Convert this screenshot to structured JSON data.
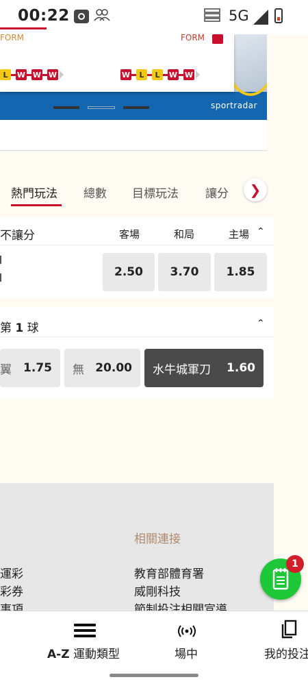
{
  "status_bar": {
    "time": "00:22",
    "network": "5G"
  },
  "match_widget": {
    "form_label_left": "FORM",
    "form_label_right": "FORM",
    "form_left": [
      "L",
      "W",
      "W",
      "W"
    ],
    "form_right": [
      "W",
      "L",
      "L",
      "W",
      "W"
    ],
    "brand": "sportradar",
    "colors": {
      "blue": "#1466b0",
      "win": "#c8102e",
      "loss": "#f4c816"
    }
  },
  "market_tabs": [
    "熱門玩法",
    "總數",
    "目標玩法",
    "讓分"
  ],
  "market_1x2": {
    "title": "不讓分",
    "columns": [
      "客場",
      "和局",
      "主場"
    ],
    "odds": [
      "2.50",
      "3.70",
      "1.85"
    ]
  },
  "first_goal": {
    "title_prefix": "第",
    "title_num": "1",
    "title_suffix": "球",
    "options": [
      {
        "label": "翼",
        "odd": "1.75"
      },
      {
        "label": "無",
        "odd": "20.00"
      },
      {
        "label": "水牛城軍刀",
        "odd": "1.60"
      }
    ]
  },
  "footer": {
    "heading": "相關連接",
    "left_links": [
      "運彩",
      "彩券",
      "事項"
    ],
    "right_links": [
      "教育部體育署",
      "威剛科技",
      "節制投注相關宣導"
    ]
  },
  "fab": {
    "badge": "1"
  },
  "bottom_nav": {
    "az_bold": "A-Z",
    "az_label": "運動類型",
    "live_label": "場中",
    "mybets_label": "我的投注"
  }
}
